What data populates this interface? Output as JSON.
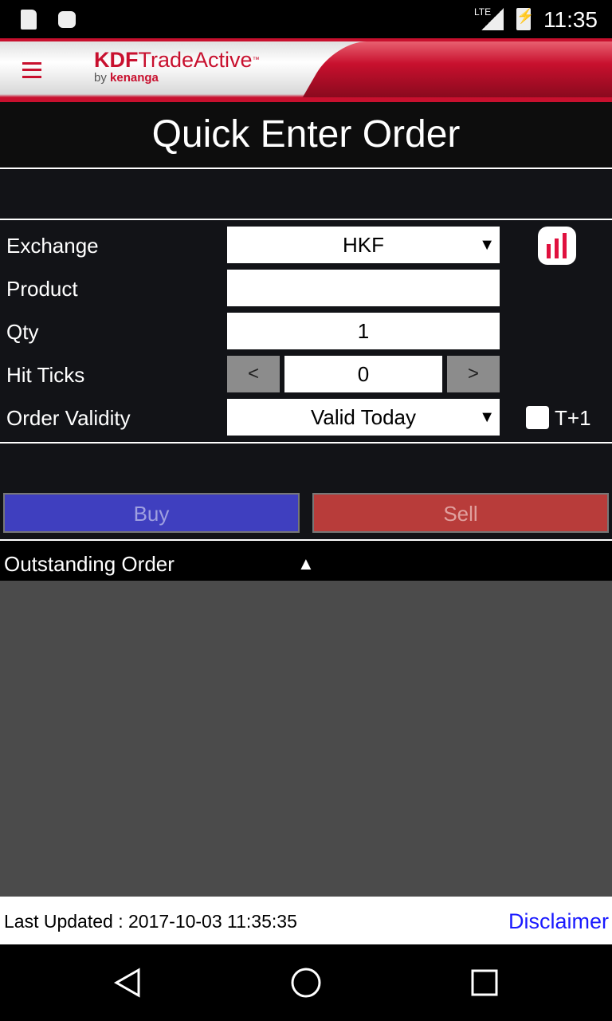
{
  "status_bar": {
    "time": "11:35",
    "network": "LTE",
    "icons": [
      "sd-card-icon",
      "android-icon",
      "signal-icon",
      "battery-charging-icon"
    ]
  },
  "header": {
    "brand_bold": "KDF",
    "brand": "TradeActive",
    "tm": "™",
    "by": "by",
    "company": "kenanga",
    "accent": "#c8102e"
  },
  "page_title": "Quick Enter Order",
  "form": {
    "exchange": {
      "label": "Exchange",
      "value": "HKF"
    },
    "product": {
      "label": "Product",
      "value": ""
    },
    "qty": {
      "label": "Qty",
      "value": "1"
    },
    "hit_ticks": {
      "label": "Hit Ticks",
      "value": "0",
      "dec": "<",
      "inc": ">"
    },
    "order_validity": {
      "label": "Order Validity",
      "value": "Valid Today"
    },
    "t1": {
      "label": "T+1",
      "checked": false
    }
  },
  "actions": {
    "buy": "Buy",
    "sell": "Sell",
    "buy_color": "#3f3fbf",
    "sell_color": "#b83c3a"
  },
  "outstanding": {
    "label": "Outstanding Order",
    "toggle": "▲"
  },
  "footer": {
    "last_updated": "Last Updated : 2017-10-03 11:35:35",
    "disclaimer": "Disclaimer"
  }
}
